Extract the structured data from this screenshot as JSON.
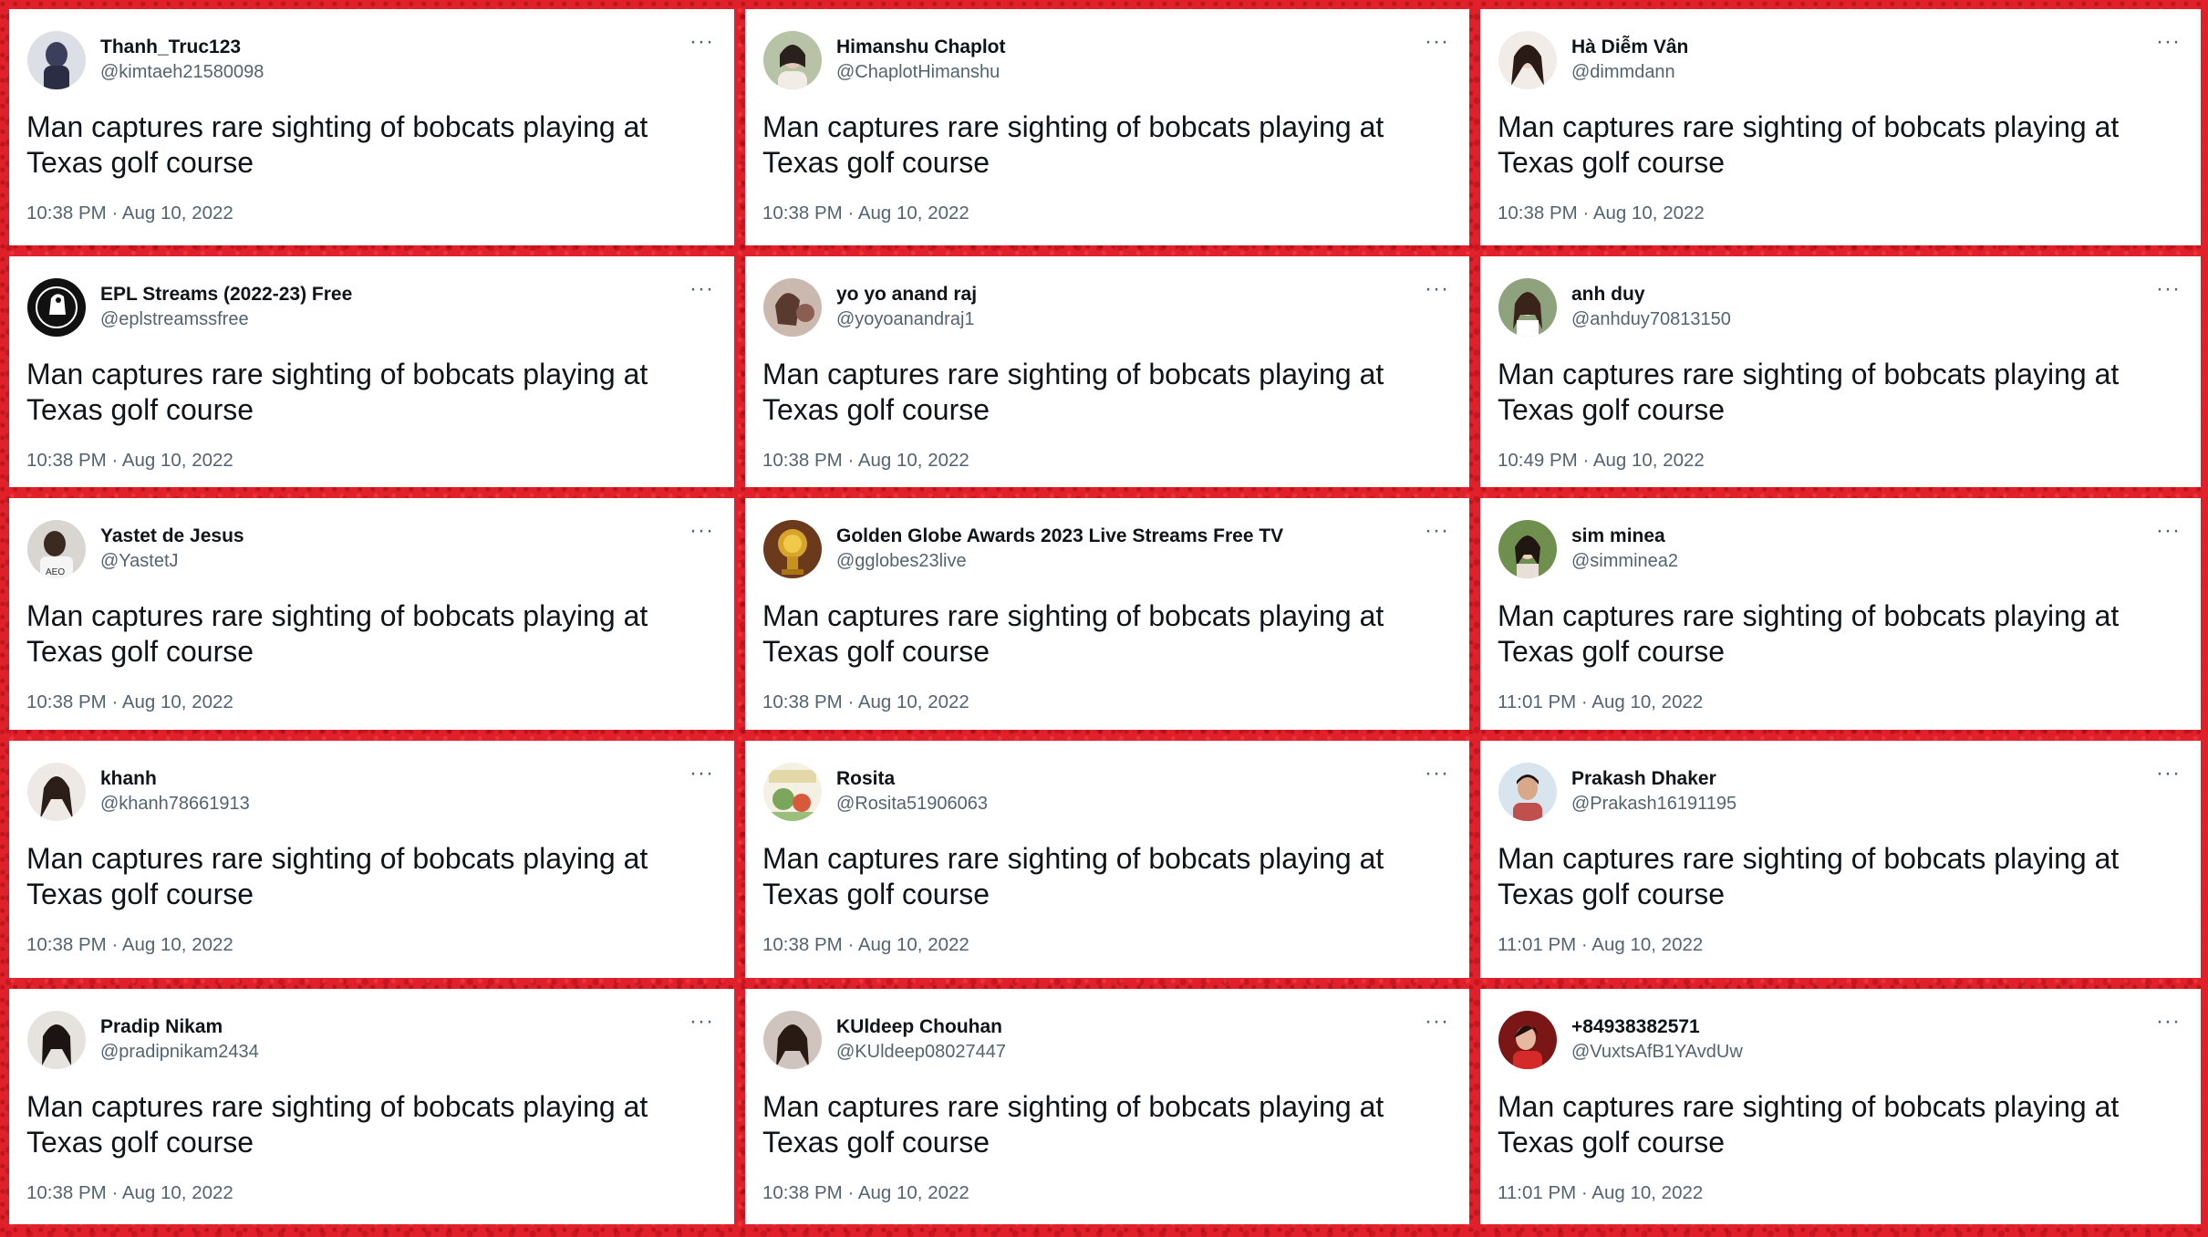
{
  "tweets": [
    {
      "name": "Thanh_Truc123",
      "handle": "@kimtaeh21580098",
      "text": "Man captures rare sighting of bobcats playing at Texas golf course",
      "time": "10:38 PM · Aug 10, 2022",
      "avatar_color": "#3b3f5c"
    },
    {
      "name": "Himanshu Chaplot",
      "handle": "@ChaplotHimanshu",
      "text": "Man captures rare sighting of bobcats playing at Texas golf course",
      "time": "10:38 PM · Aug 10, 2022",
      "avatar_color": "#7c8a6a"
    },
    {
      "name": "Hà Diễm Vân",
      "handle": "@dimmdann",
      "text": "Man captures rare sighting of bobcats playing at Texas golf course",
      "time": "10:38 PM · Aug 10, 2022",
      "avatar_color": "#c9b8b0"
    },
    {
      "name": "EPL Streams (2022-23) Free",
      "handle": "@eplstreamssfree",
      "text": "Man captures rare sighting of bobcats playing at Texas golf course",
      "time": "10:38 PM · Aug 10, 2022",
      "avatar_color": "#111111"
    },
    {
      "name": "yo yo anand raj",
      "handle": "@yoyoanandraj1",
      "text": "Man captures rare sighting of bobcats playing at Texas golf course",
      "time": "10:38 PM · Aug 10, 2022",
      "avatar_color": "#a07a6a"
    },
    {
      "name": "anh duy",
      "handle": "@anhduy70813150",
      "text": "Man captures rare sighting of bobcats playing at Texas golf course",
      "time": "10:49 PM · Aug 10, 2022",
      "avatar_color": "#5a6b52"
    },
    {
      "name": "Yastet de Jesus",
      "handle": "@YastetJ",
      "text": "Man captures rare sighting of bobcats playing at Texas golf course",
      "time": "10:38 PM · Aug 10, 2022",
      "avatar_color": "#3a2a22"
    },
    {
      "name": "Golden Globe Awards 2023 Live Streams Free TV",
      "handle": "@gglobes23live",
      "text": "Man captures rare sighting of bobcats playing at Texas golf course",
      "time": "10:38 PM · Aug 10, 2022",
      "avatar_color": "#b8860b"
    },
    {
      "name": "sim minea",
      "handle": "@simminea2",
      "text": "Man captures rare sighting of bobcats playing at Texas golf course",
      "time": "11:01 PM · Aug 10, 2022",
      "avatar_color": "#4f6e3a"
    },
    {
      "name": "khanh",
      "handle": "@khanh78661913",
      "text": "Man captures rare sighting of bobcats playing at Texas golf course",
      "time": "10:38 PM · Aug 10, 2022",
      "avatar_color": "#d8c8c0"
    },
    {
      "name": "Rosita",
      "handle": "@Rosita51906063",
      "text": "Man captures rare sighting of bobcats playing at Texas golf course",
      "time": "10:38 PM · Aug 10, 2022",
      "avatar_color": "#9bbf7a"
    },
    {
      "name": "Prakash Dhaker",
      "handle": "@Prakash16191195",
      "text": "Man captures rare sighting of bobcats playing at Texas golf course",
      "time": "11:01 PM · Aug 10, 2022",
      "avatar_color": "#c0504d"
    },
    {
      "name": "Pradip Nikam",
      "handle": "@pradipnikam2434",
      "text": "Man captures rare sighting of bobcats playing at Texas golf course",
      "time": "10:38 PM · Aug 10, 2022",
      "avatar_color": "#2b2b2b"
    },
    {
      "name": "KUldeep Chouhan",
      "handle": "@KUldeep08027447",
      "text": "Man captures rare sighting of bobcats playing at Texas golf course",
      "time": "10:38 PM · Aug 10, 2022",
      "avatar_color": "#4a3b35"
    },
    {
      "name": "+84938382571",
      "handle": "@VuxtsAfB1YAvdUw",
      "text": "Man captures rare sighting of bobcats playing at Texas golf course",
      "time": "11:01 PM · Aug 10, 2022",
      "avatar_color": "#c22a2a"
    }
  ],
  "more_label": "···",
  "colors": {
    "background": "#e0202a",
    "card": "#ffffff",
    "text": "#0f1419",
    "secondary": "#536471"
  }
}
